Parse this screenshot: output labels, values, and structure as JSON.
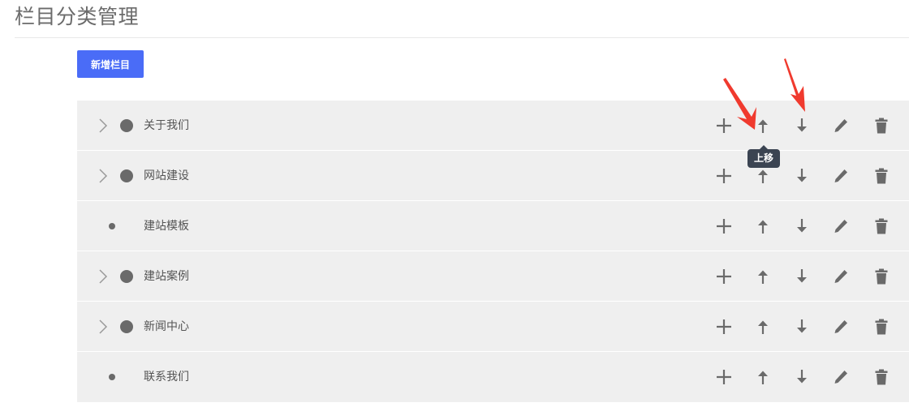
{
  "page": {
    "title": "栏目分类管理"
  },
  "toolbar": {
    "add_label": "新增栏目"
  },
  "categories": [
    {
      "label": "关于我们",
      "expandable": true
    },
    {
      "label": "网站建设",
      "expandable": true
    },
    {
      "label": "建站模板",
      "expandable": false
    },
    {
      "label": "建站案例",
      "expandable": true
    },
    {
      "label": "新闻中心",
      "expandable": true
    },
    {
      "label": "联系我们",
      "expandable": false
    }
  ],
  "actions": [
    "plus-icon",
    "arrow-up-icon",
    "arrow-down-icon",
    "pencil-icon",
    "trash-icon"
  ],
  "tooltip": {
    "text": "上移"
  },
  "colors": {
    "primary_button": "#4a6cf7",
    "row_background": "#efefef",
    "icon": "#6a6a6a",
    "tooltip_background": "#3b4452",
    "annotation_arrow": "#f03a2e"
  }
}
